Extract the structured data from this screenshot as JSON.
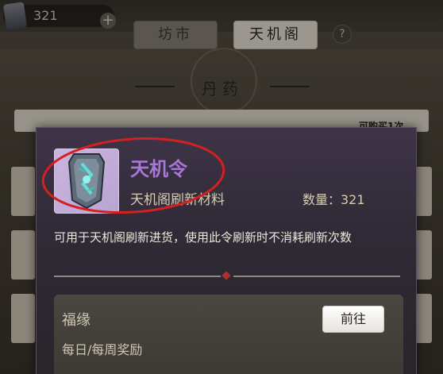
{
  "header": {
    "currency_value": "321",
    "plus_symbol": "+",
    "tabs": [
      {
        "label": "坊市",
        "active": false
      },
      {
        "label": "天机阁",
        "active": true
      }
    ],
    "help_symbol": "?"
  },
  "shop": {
    "section_title": "丹药",
    "buy_limit": "可购买1次"
  },
  "popup": {
    "item_name": "天机令",
    "item_subtitle": "天机阁刷新材料",
    "quantity_label": "数量：321",
    "description": "可用于天机阁刷新进货，使用此令刷新时不消耗刷新次数",
    "source": {
      "title": "福缘",
      "description": "每日/每周奖励",
      "goto_label": "前往"
    }
  },
  "colors": {
    "item_name": "#a878d8",
    "highlight_ellipse": "#d42020",
    "active_tab": "#efe9dc"
  },
  "icons": {
    "item": "tianji-token-icon",
    "currency": "tianji-token-icon"
  }
}
